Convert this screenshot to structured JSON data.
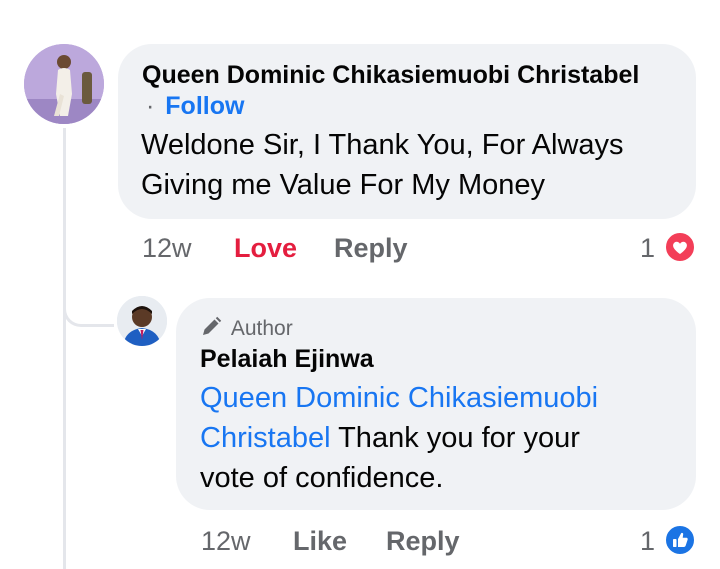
{
  "comment": {
    "author": "Queen Dominic Chikasiemuobi Christabel",
    "follow_prefix": "·",
    "follow_label": "Follow",
    "text_line1": "Weldone Sir, I Thank You, For Always",
    "text_line2": "Giving me Value For My Money",
    "time": "12w",
    "reaction_action": "Love",
    "reply_label": "Reply",
    "reaction_count": "1",
    "reaction_icon": "heart-icon"
  },
  "reply": {
    "badge_label": "Author",
    "author": "Pelaiah Ejinwa",
    "mention_line1": "Queen Dominic Chikasiemuobi",
    "mention_line2": "Christabel",
    "text_line2_rest": " Thank you for your",
    "text_line3": "vote of confidence.",
    "time": "12w",
    "like_label": "Like",
    "reply_label": "Reply",
    "reaction_count": "1",
    "reaction_icon": "thumbs-up-icon"
  },
  "colors": {
    "bubble": "#f0f2f5",
    "link": "#1876f2",
    "love": "#e41e3f",
    "secondary": "#65676b"
  }
}
